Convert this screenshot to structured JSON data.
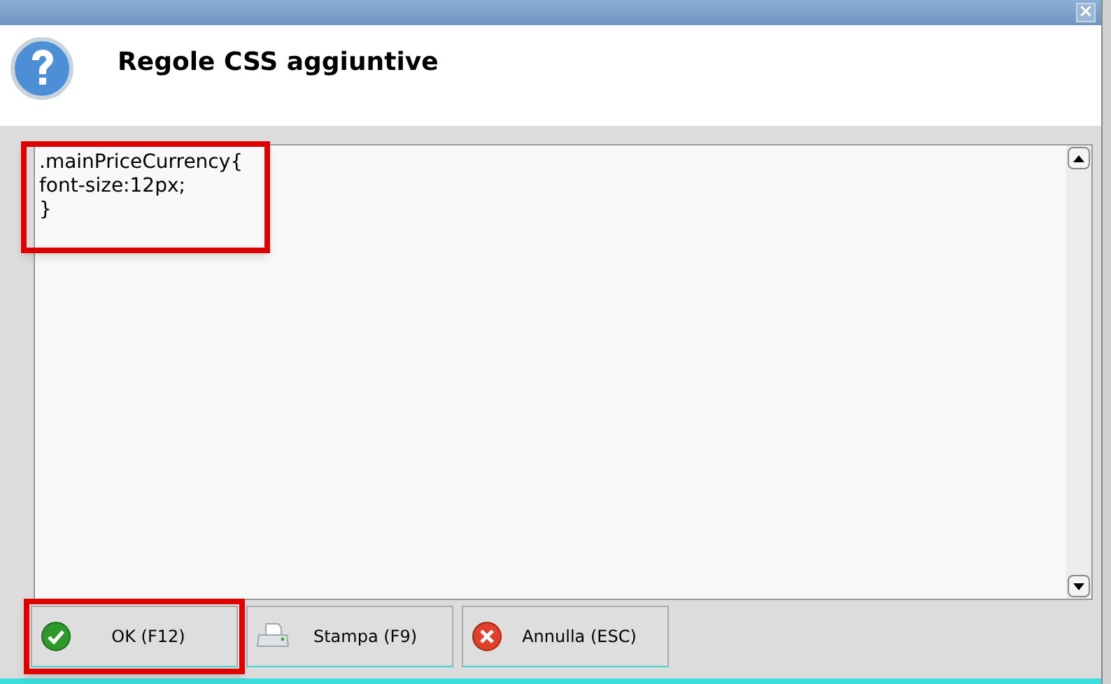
{
  "window": {
    "title": "Regole CSS aggiuntive",
    "close_label": "×"
  },
  "editor": {
    "lines": [
      ".mainPriceCurrency{",
      "font-size:12px;",
      "}"
    ],
    "highlighted": true
  },
  "buttons": [
    {
      "label": "OK (F12)",
      "kind": "ok",
      "highlighted": true
    },
    {
      "label": "Stampa (F9)",
      "kind": "print",
      "highlighted": false
    },
    {
      "label": "Annulla (ESC)",
      "kind": "cancel",
      "highlighted": false
    }
  ]
}
